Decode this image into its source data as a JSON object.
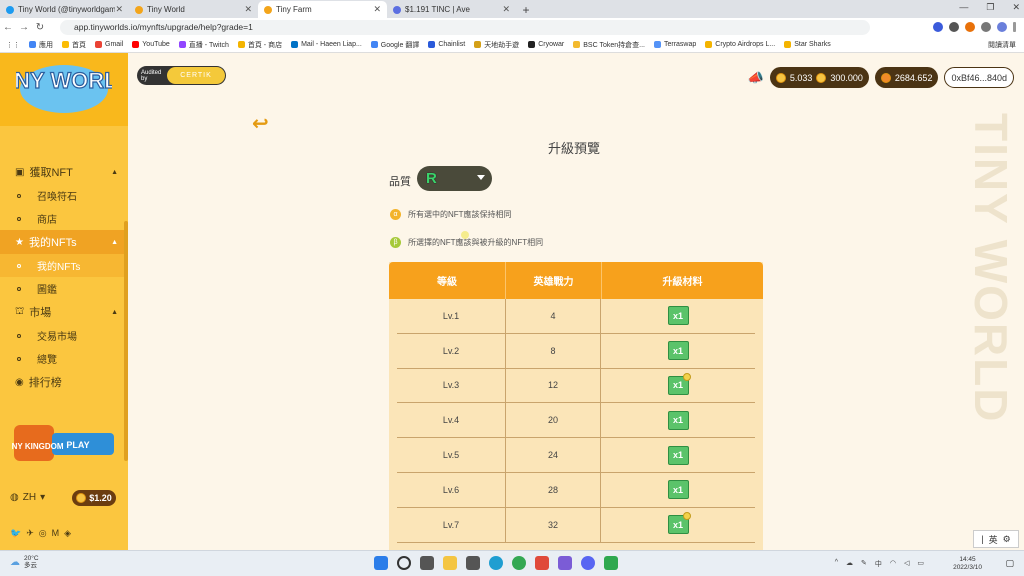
{
  "browser": {
    "tabs": [
      {
        "title": "Tiny World (@tinyworldgamefi)...",
        "color": "#1d9bf0",
        "active": false
      },
      {
        "title": "Tiny World",
        "color": "#f3a51b",
        "active": false
      },
      {
        "title": "Tiny Farm",
        "color": "#f3a51b",
        "active": true
      },
      {
        "title": "$1.191 TINC | Ave",
        "color": "#5b6ee1",
        "active": false
      }
    ],
    "url": "app.tinyworlds.io/mynfts/upgrade/help?grade=1",
    "bookmarks": [
      {
        "label": "應用",
        "color": "#4285f4"
      },
      {
        "label": "首頁",
        "color": "#fbbc05"
      },
      {
        "label": "Gmail",
        "color": "#ea4335"
      },
      {
        "label": "YouTube",
        "color": "#ff0000"
      },
      {
        "label": "直播 - Twitch",
        "color": "#9146ff"
      },
      {
        "label": "首頁 - 商店",
        "color": "#f4b400"
      },
      {
        "label": "Mail - Haeen Liap...",
        "color": "#0072c6"
      },
      {
        "label": "Google 翻譯",
        "color": "#4285f4"
      },
      {
        "label": "Chainlist",
        "color": "#2a5ada"
      },
      {
        "label": "天地劫手遊",
        "color": "#d4a017"
      },
      {
        "label": "Cryowar",
        "color": "#222222"
      },
      {
        "label": "BSC Token持倉查...",
        "color": "#f3ba2f"
      },
      {
        "label": "Terraswap",
        "color": "#5493f7"
      },
      {
        "label": "Crypto Airdrops L...",
        "color": "#f4b400"
      },
      {
        "label": "Star Sharks",
        "color": "#f4b400"
      }
    ],
    "bookmarks_right": "閱讀清單"
  },
  "sidebar": {
    "menu": [
      {
        "type": "head",
        "icon": "box-icon",
        "glyph": "▣",
        "label": "獲取NFT",
        "active": false
      },
      {
        "type": "sub",
        "label": "召喚符石",
        "active": false
      },
      {
        "type": "sub",
        "label": "商店",
        "active": false
      },
      {
        "type": "head",
        "icon": "star-icon",
        "glyph": "★",
        "label": "我的NFTs",
        "active": true
      },
      {
        "type": "sub",
        "label": "我的NFTs",
        "active": true
      },
      {
        "type": "sub",
        "label": "圖鑑",
        "active": false
      },
      {
        "type": "head",
        "icon": "market-icon",
        "glyph": "⛫",
        "label": "市場",
        "active": false
      },
      {
        "type": "sub",
        "label": "交易市場",
        "active": false
      },
      {
        "type": "sub",
        "label": "總覽",
        "active": false
      },
      {
        "type": "head",
        "icon": "ranking-icon",
        "glyph": "◉",
        "label": "排行榜",
        "active": false
      }
    ],
    "kingdom_play": "PLAY",
    "kingdom_logo": "TINY KINGDOM",
    "language": "ZH",
    "token_price": "$1.20"
  },
  "header": {
    "certik_audited": "Audited by",
    "certik_name": "CERTIK",
    "balance_1": "5.033",
    "balance_2": "300.000",
    "balance_3": "2684.652",
    "wallet": "0xBf46...840d"
  },
  "logo_text": "TINY WORLD",
  "page": {
    "title": "升級預覽",
    "quality_label": "品質",
    "quality_value": "R",
    "note_alpha": "所有選中的NFT應該保持相同",
    "note_beta": "所選擇的NFT應該與被升級的NFT相同",
    "watermark": "TINY WORLD"
  },
  "table": {
    "headers": [
      "等級",
      "英雄戰力",
      "升級材料"
    ],
    "rows": [
      {
        "level": "Lv.1",
        "power": "4",
        "material": "x1",
        "star": false
      },
      {
        "level": "Lv.2",
        "power": "8",
        "material": "x1",
        "star": false
      },
      {
        "level": "Lv.3",
        "power": "12",
        "material": "x1",
        "star": true
      },
      {
        "level": "Lv.4",
        "power": "20",
        "material": "x1",
        "star": false
      },
      {
        "level": "Lv.5",
        "power": "24",
        "material": "x1",
        "star": false
      },
      {
        "level": "Lv.6",
        "power": "28",
        "material": "x1",
        "star": false
      },
      {
        "level": "Lv.7",
        "power": "32",
        "material": "x1",
        "star": true
      }
    ]
  },
  "taskbar": {
    "temp": "20°C",
    "weather": "多云",
    "time": "14:45",
    "date": "2022/3/10",
    "ime": "英"
  }
}
